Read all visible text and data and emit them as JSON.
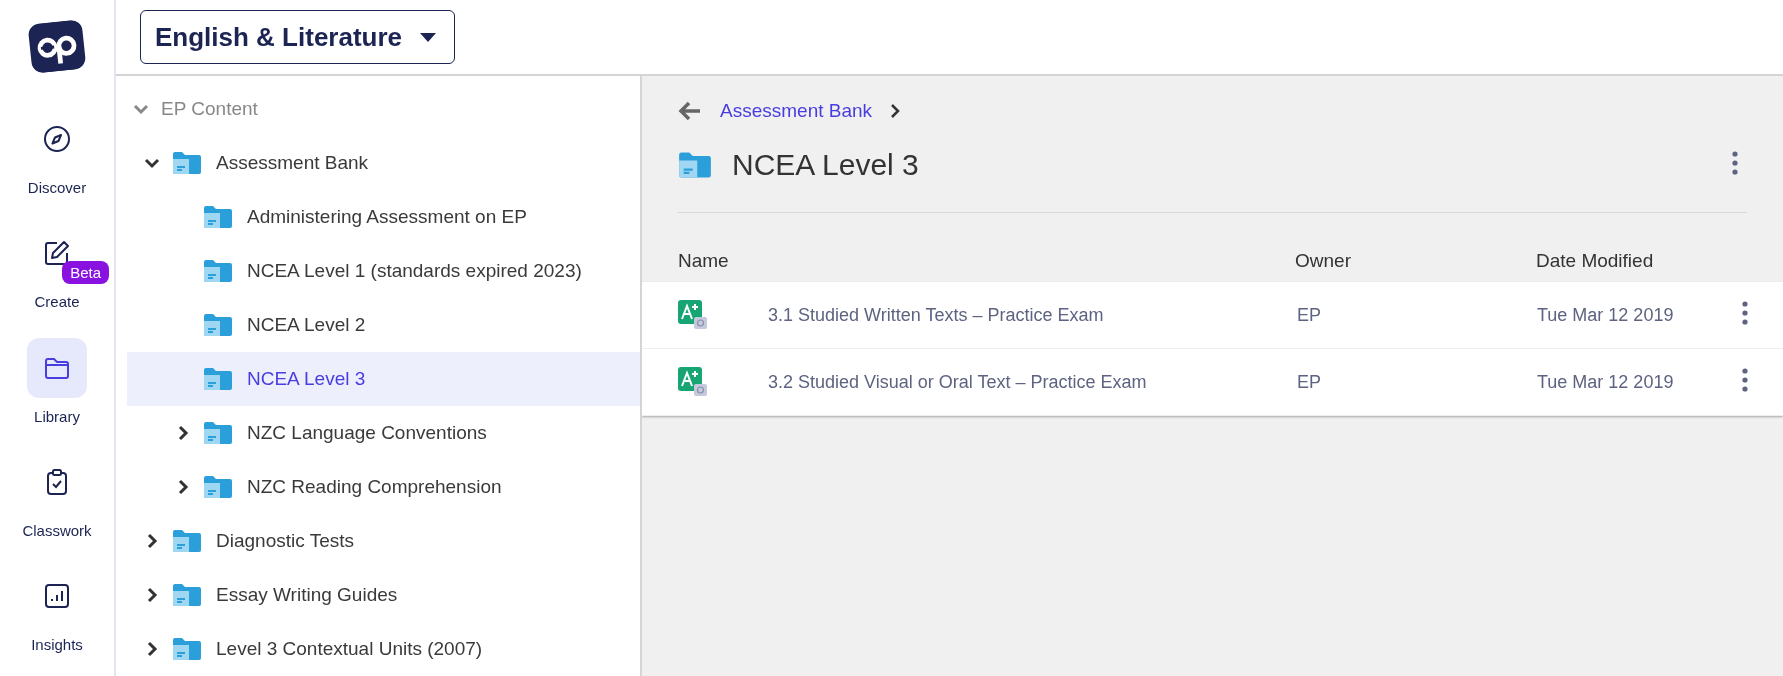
{
  "nav": {
    "items": [
      {
        "label": "Discover",
        "kind": "compass",
        "selected": false
      },
      {
        "label": "Create",
        "kind": "pencil",
        "selected": false,
        "badge": "Beta"
      },
      {
        "label": "Library",
        "kind": "folder",
        "selected": true
      },
      {
        "label": "Classwork",
        "kind": "clipboard",
        "selected": false
      },
      {
        "label": "Insights",
        "kind": "chart",
        "selected": false
      }
    ]
  },
  "subject_select": {
    "value": "English & Literature"
  },
  "tree": {
    "root": {
      "label": "EP Content",
      "expanded": true
    },
    "items": [
      {
        "label": "Assessment Bank",
        "expanded": true,
        "selected": false,
        "children": [
          {
            "label": "Administering Assessment on EP",
            "selected": false
          },
          {
            "label": "NCEA Level 1 (standards expired 2023)",
            "selected": false
          },
          {
            "label": "NCEA Level 2",
            "selected": false
          },
          {
            "label": "NCEA Level 3",
            "selected": true
          },
          {
            "label": "NZC Language Conventions",
            "expanded": false,
            "selected": false
          },
          {
            "label": "NZC Reading Comprehension",
            "expanded": false,
            "selected": false
          }
        ]
      },
      {
        "label": "Diagnostic Tests",
        "expanded": false,
        "selected": false
      },
      {
        "label": "Essay Writing Guides",
        "expanded": false,
        "selected": false
      },
      {
        "label": "Level 3 Contextual Units (2007)",
        "expanded": false,
        "selected": false
      }
    ]
  },
  "breadcrumb": {
    "items": [
      "Assessment Bank"
    ]
  },
  "folder_title": "NCEA Level 3",
  "table": {
    "columns": [
      "Name",
      "Owner",
      "Date Modified"
    ],
    "rows": [
      {
        "name": "3.1 Studied Written Texts – Practice Exam",
        "owner": "EP",
        "date": "Tue Mar 12 2019"
      },
      {
        "name": "3.2 Studied Visual or Oral Text – Practice Exam",
        "owner": "EP",
        "date": "Tue Mar 12 2019"
      }
    ]
  }
}
